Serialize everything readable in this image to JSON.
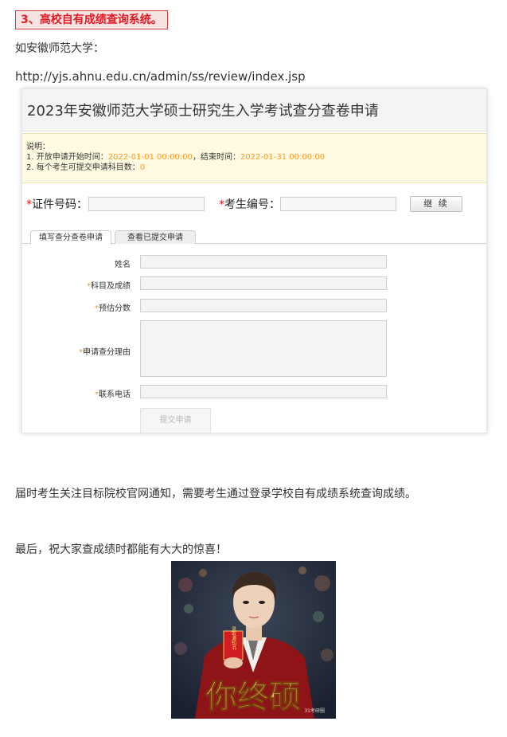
{
  "heading": "3、高校自有成绩查询系统。",
  "intro": "如安徽师范大学：",
  "url": "http://yjs.ahnu.edu.cn/admin/ss/review/index.jsp",
  "panel": {
    "title": "2023年安徽师范大学硕士研究生入学考试查分查卷申请",
    "notice_label": "说明：",
    "notice_line1_prefix": "1. 开放申请开始时间：",
    "notice_start": "2022-01-01 00:00:00",
    "notice_end_label": "，结束时间：",
    "notice_end": "2022-01-31 00:00:00",
    "notice_line2_prefix": "2. 每个考生可提交申请科目数：",
    "notice_count": "0",
    "id_label": "证件号码：",
    "exam_label": "考生编号：",
    "continue_button": "继 续",
    "tab_active": "填写查分查卷申请",
    "tab_inactive": "查看已提交申请",
    "fields": {
      "name": "姓名",
      "subject": "科目及成绩",
      "estimate": "预估分数",
      "reason": "申请查分理由",
      "phone": "联系电话"
    },
    "submit_button": "提交申请"
  },
  "para1": "届时考生关注目标院校官网通知，需要考生通过登录学校自有成绩系统查询成绩。",
  "para2": "最后，祝大家查成绩时都能有大大的惊喜！",
  "photo": {
    "letter_text": "录取通知书",
    "caption": "你终硕",
    "watermark": "31考研圈"
  },
  "colors": {
    "heading_red": "#e31b23",
    "notice_orange": "#f39a21",
    "notice_bg": "#fffbe2"
  }
}
